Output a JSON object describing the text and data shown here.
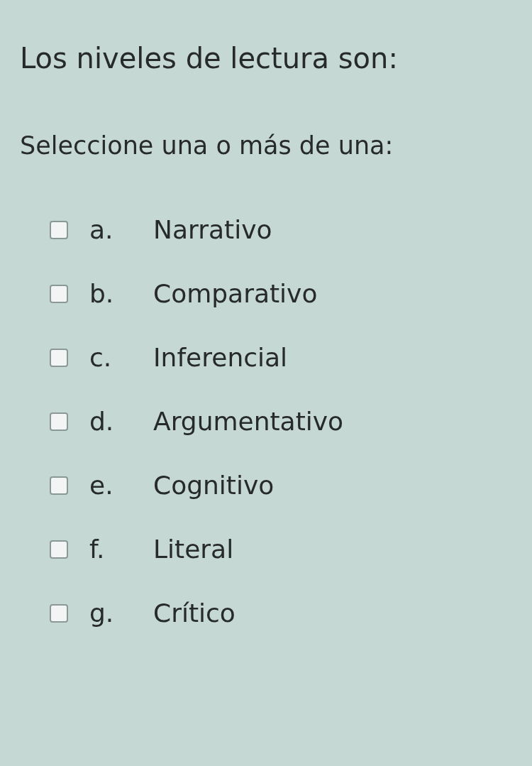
{
  "question": "Los niveles de lectura son:",
  "instruction": "Seleccione una o más de una:",
  "options": [
    {
      "letter": "a.",
      "label": "Narrativo",
      "checked": false
    },
    {
      "letter": "b.",
      "label": "Comparativo",
      "checked": false
    },
    {
      "letter": "c.",
      "label": "Inferencial",
      "checked": false
    },
    {
      "letter": "d.",
      "label": "Argumentativo",
      "checked": false
    },
    {
      "letter": "e.",
      "label": "Cognitivo",
      "checked": false
    },
    {
      "letter": "f.",
      "label": "Literal",
      "checked": false
    },
    {
      "letter": "g.",
      "label": "Crítico",
      "checked": false
    }
  ]
}
